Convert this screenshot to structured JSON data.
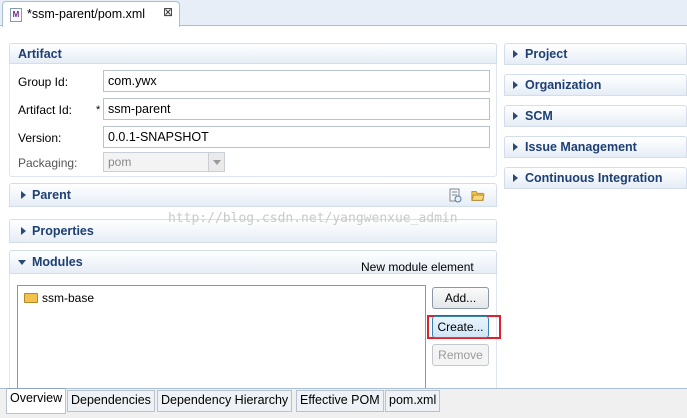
{
  "editor_tab": {
    "title": "*ssm-parent/pom.xml",
    "icon": "maven-pom-file-icon",
    "close_glyph": "⊠"
  },
  "artifact": {
    "title": "Artifact",
    "group_id_label": "Group Id:",
    "group_id_value": "com.ywx",
    "artifact_id_label": "Artifact Id:",
    "required_marker": "*",
    "artifact_id_value": "ssm-parent",
    "version_label": "Version:",
    "version_value": "0.0.1-SNAPSHOT",
    "packaging_label": "Packaging:",
    "packaging_value": "pom"
  },
  "parent": {
    "title": "Parent"
  },
  "properties": {
    "title": "Properties"
  },
  "modules": {
    "title": "Modules",
    "new_module_label": "New module element",
    "items": [
      {
        "label": "ssm-base"
      }
    ],
    "add_button": "Add...",
    "create_button": "Create...",
    "remove_button": "Remove"
  },
  "right_sections": [
    {
      "title": "Project"
    },
    {
      "title": "Organization"
    },
    {
      "title": "SCM"
    },
    {
      "title": "Issue Management"
    },
    {
      "title": "Continuous Integration"
    }
  ],
  "watermark": "http://blog.csdn.net/yangwenxue_admin",
  "bottom_tabs": [
    {
      "label": "Overview",
      "active": true
    },
    {
      "label": "Dependencies"
    },
    {
      "label": "Dependency Hierarchy"
    },
    {
      "label": "Effective POM"
    },
    {
      "label": "pom.xml"
    }
  ],
  "colors": {
    "section_title": "#1d3f73",
    "highlight": "#e0202a"
  }
}
